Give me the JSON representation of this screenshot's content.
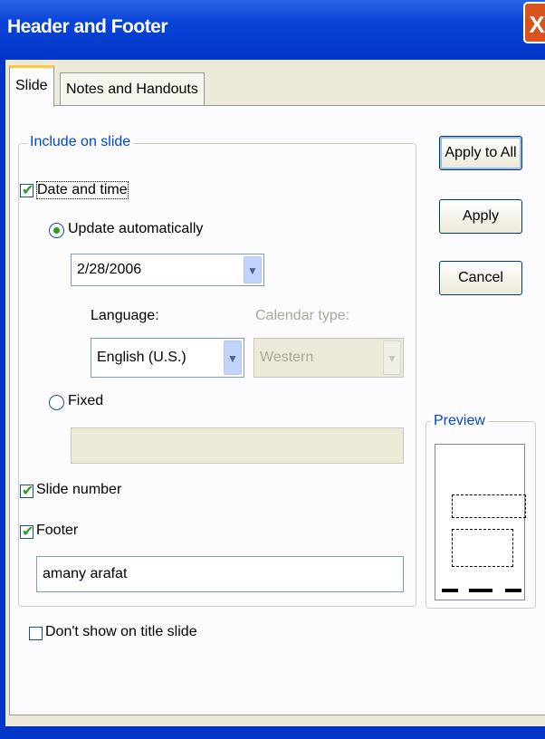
{
  "window": {
    "title": "Header and Footer",
    "close_glyph": "X"
  },
  "tabs": [
    {
      "label": "Slide",
      "active": true
    },
    {
      "label": "Notes and Handouts",
      "active": false
    }
  ],
  "include_group": {
    "legend": "Include on slide"
  },
  "date_time": {
    "checkbox": {
      "label": "Date and time",
      "checked": true
    },
    "update_auto": {
      "label": "Update automatically",
      "selected": true
    },
    "date_value": "2/28/2006",
    "language": {
      "label": "Language:",
      "value": "English (U.S.)"
    },
    "calendar_type": {
      "label": "Calendar type:",
      "value": "Western",
      "enabled": false
    },
    "fixed": {
      "label": "Fixed",
      "selected": false,
      "value": ""
    }
  },
  "slide_number": {
    "label": "Slide number",
    "checked": true
  },
  "footer": {
    "label": "Footer",
    "checked": true,
    "value": "amany arafat"
  },
  "dont_show_title": {
    "label": "Don't show on title slide",
    "checked": false
  },
  "buttons": {
    "apply_all": "Apply to All",
    "apply": "Apply",
    "cancel": "Cancel"
  },
  "preview": {
    "legend": "Preview"
  },
  "icons": {
    "check": "✔",
    "dropdown": "chevron-down-icon",
    "dropdown_glyph": "▼"
  },
  "colors": {
    "titlebar": "#0036c6",
    "group_legend": "#0046d5",
    "check": "#21a121"
  }
}
